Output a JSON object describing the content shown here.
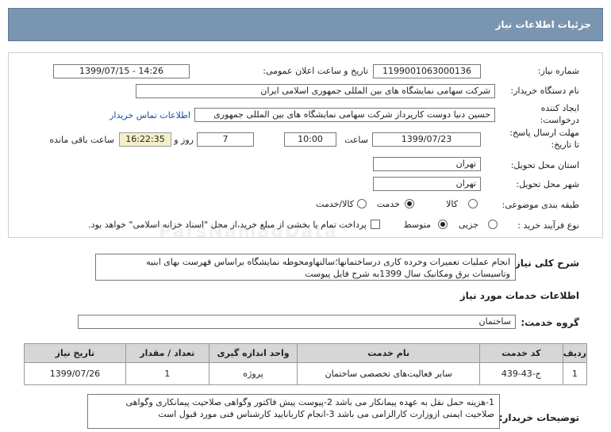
{
  "title": "جزئیات اطلاعات نیاز",
  "labels": {
    "need_number": "شماره نیاز:",
    "announce_datetime": "تاریخ و ساعت اعلان عمومی:",
    "buyer_org": "نام دستگاه خریدار:",
    "creator_line1": "ایجاد کننده",
    "creator_line2": "درخواست:",
    "deadline_line1": "مهلت ارسال پاسخ:",
    "deadline_line2": "تا تاریخ:",
    "hour": "ساعت",
    "day_and": "روز و",
    "remaining": "ساعت باقی مانده",
    "province": "استان محل تحویل:",
    "city": "شهر محل تحویل:",
    "category": "طبقه بندی موضوعی:",
    "process": "نوع فرآیند خرید :",
    "general_desc": "شرح کلی نیاز:",
    "services_info": "اطلاعات خدمات مورد نیاز",
    "service_group": "گروه خدمت:",
    "buyer_notes": "توضیحات خریدار:"
  },
  "values": {
    "need_number": "1199001063000136",
    "announce_datetime": "1399/07/15 - 14:26",
    "buyer_org": "شرکت سهامی نمایشگاه های بین المللی جمهوری اسلامی ایران",
    "creator": "حسین دنیا دوست کارپرداز شرکت سهامی نمایشگاه های بین المللی جمهوری",
    "contact_link": "اطلاعات تماس خریدار",
    "deadline_date": "1399/07/23",
    "deadline_time": "10:00",
    "days": "7",
    "remaining_time": "16:22:35",
    "province": "تهران",
    "city": "تهران",
    "service_group": "ساختمان"
  },
  "category_options": [
    {
      "label": "کالا",
      "selected": false
    },
    {
      "label": "خدمت",
      "selected": true
    },
    {
      "label": "کالا/خدمت",
      "selected": false
    }
  ],
  "process_options": [
    {
      "label": "جزیی",
      "selected": false
    },
    {
      "label": "متوسط",
      "selected": true
    }
  ],
  "payment_note": "پرداخت تمام یا بخشی از مبلغ خرید،از محل \"اسناد خزانه اسلامی\" خواهد بود.",
  "general_desc_text": {
    "line1": "انجام عملیات تعمیرات وخرده کاری درساختمانها؛سالنهاومحوطه نمایشگاه براساس فهرست بهای ابنیه",
    "line2": "وتاسیسات برق ومکانیک سال 1399به شرح فایل پیوست"
  },
  "table": {
    "headers": [
      "ردیف",
      "کد خدمت",
      "نام خدمت",
      "واحد اندازه گیری",
      "تعداد / مقدار",
      "تاریخ نیاز"
    ],
    "rows": [
      [
        "1",
        "ج-43-439",
        "سایر فعالیت‌های تخصصی ساختمان",
        "پروژه",
        "1",
        "1399/07/26"
      ]
    ]
  },
  "buyer_notes_text": {
    "line1": "1-هزینه حمل نقل به عهده پیمانکار می باشد 2-پیوست پیش فاکتور وگواهی صلاحیت پیمانکاری وگواهی",
    "line2": "صلاحیت ایمنی ازوزارت کارالزامی می باشد 3-انجام کاربانایید کارشناس فنی مورد قبول است"
  },
  "watermark": "ParsNamadData"
}
